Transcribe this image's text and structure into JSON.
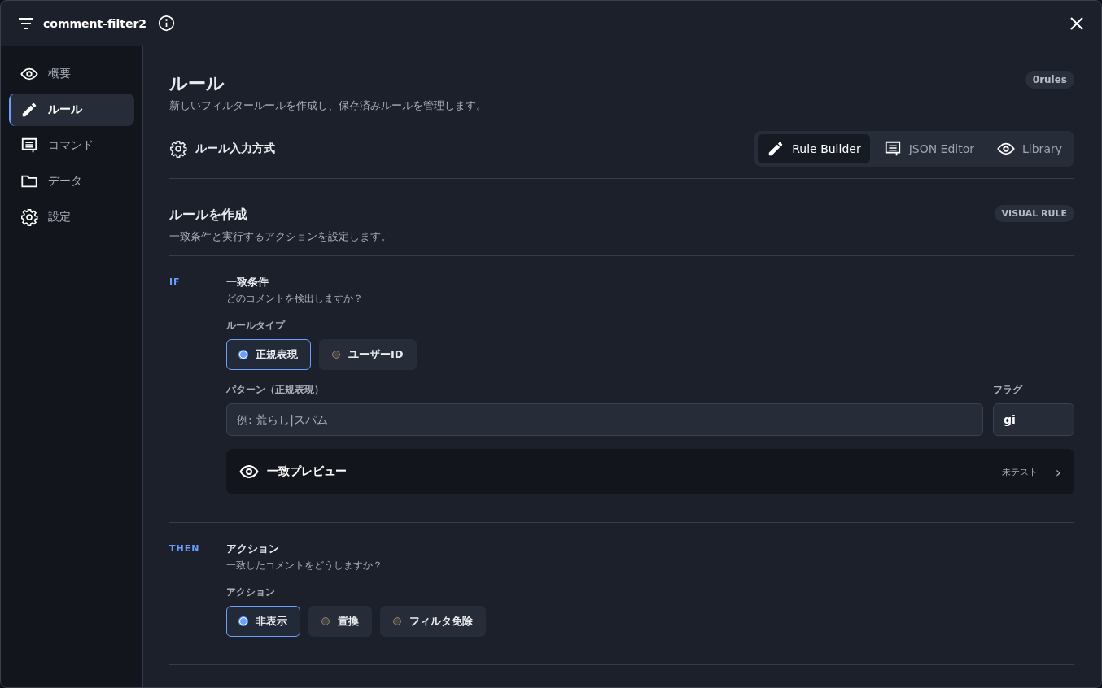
{
  "window": {
    "title": "comment-filter2"
  },
  "sidebar": {
    "items": [
      {
        "label": "概要",
        "kind": "eye",
        "selected": false
      },
      {
        "label": "ルール",
        "kind": "pencil",
        "selected": true
      },
      {
        "label": "コマンド",
        "kind": "comment",
        "selected": false
      },
      {
        "label": "データ",
        "kind": "folder",
        "selected": false
      },
      {
        "label": "設定",
        "kind": "gear",
        "selected": false
      }
    ]
  },
  "page": {
    "title": "ルール",
    "subtitle": "新しいフィルタールールを作成し、保存済みルールを管理します。",
    "badge": "0rules"
  },
  "input_mode": {
    "label": "ルール入力方式",
    "tabs": [
      {
        "label": "Rule Builder",
        "kind": "pencil",
        "selected": true
      },
      {
        "label": "JSON Editor",
        "kind": "comment",
        "selected": false
      },
      {
        "label": "Library",
        "kind": "eye",
        "selected": false
      }
    ]
  },
  "builder": {
    "title": "ルールを作成",
    "subtitle": "一致条件と実行するアクションを設定します。",
    "badge": "VISUAL RULE"
  },
  "if_section": {
    "tag": "IF",
    "title": "一致条件",
    "subtitle": "どのコメントを検出しますか？",
    "rule_type_label": "ルールタイプ",
    "rule_types": [
      {
        "label": "正規表現",
        "selected": true
      },
      {
        "label": "ユーザーID",
        "selected": false
      }
    ],
    "pattern_label": "パターン（正規表現）",
    "pattern_placeholder": "例: 荒らし|スパム",
    "flags_label": "フラグ",
    "flags_value": "gi",
    "preview": {
      "label": "一致プレビュー",
      "status": "未テスト",
      "chevron": "›"
    }
  },
  "then_section": {
    "tag": "THEN",
    "title": "アクション",
    "subtitle": "一致したコメントをどうしますか？",
    "action_label": "アクション",
    "actions": [
      {
        "label": "非表示",
        "selected": true
      },
      {
        "label": "置換",
        "selected": false
      },
      {
        "label": "フィルタ免除",
        "selected": false
      }
    ]
  }
}
